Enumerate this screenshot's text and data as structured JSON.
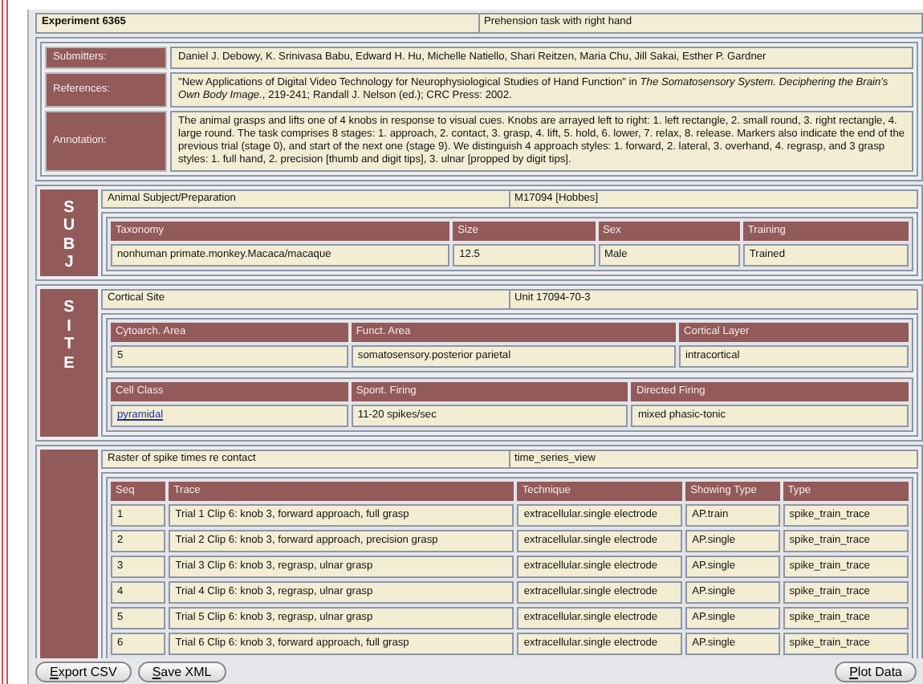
{
  "experiment": {
    "title": "Experiment 6365",
    "description": "Prehension task with right hand"
  },
  "info": [
    {
      "label": "Submitters:",
      "value": "Daniel J. Debowy, K. Srinivasa Babu, Edward H. Hu, Michelle Natiello, Shari Reitzen, Maria Chu, Jill Sakai, Esther P. Gardner"
    },
    {
      "label": "References:",
      "value": "\"New Applications of Digital Video Technology for Neurophysiological Studies of Hand Function\" in *The Somatosensory System. Deciphering the Brain's Own Body Image.*, 219-241; Randall J. Nelson (ed.); CRC Press: 2002."
    },
    {
      "label": "Annotation:",
      "value": "The animal grasps and lifts one of 4 knobs in response to visual cues. Knobs are arrayed left to right: 1. left rectangle, 2. small round, 3. right rectangle, 4. large round. The task comprises 8 stages: 1. approach, 2. contact, 3. grasp, 4. lift, 5. hold, 6. lower, 7. relax, 8. release. Markers also indicate the end of the previous trial (stage 0), and start of the next one (stage 9). We distinguish 4 approach styles: 1. forward, 2. lateral, 3. overhand, 4. regrasp, and 3 grasp styles: 1. full hand, 2. precision [thumb and digit tips], 3. ulnar [propped by digit tips]."
    }
  ],
  "sections": [
    {
      "side_label": "SUBJ",
      "title": "Animal Subject/Preparation",
      "value": "M17094 [Hobbes]",
      "tables": [
        {
          "columns": [
            "Taxonomy",
            "Size",
            "Sex",
            "Training"
          ],
          "rows": [
            [
              {
                "text": "nonhuman primate.monkey.Macaca/macaque"
              },
              {
                "text": "12.5"
              },
              {
                "text": "Male"
              },
              {
                "text": "Trained"
              }
            ]
          ]
        }
      ]
    },
    {
      "side_label": "SITE",
      "title": "Cortical Site",
      "value": "Unit 17094-70-3",
      "tables": [
        {
          "columns": [
            "Cytoarch. Area",
            "Funct. Area",
            "Cortical Layer"
          ],
          "rows": [
            [
              {
                "text": "5"
              },
              {
                "text": "somatosensory.posterior parietal"
              },
              {
                "text": "intracortical"
              }
            ]
          ]
        },
        {
          "columns": [
            "Cell Class",
            "Spont. Firing",
            "Directed Firing"
          ],
          "rows": [
            [
              {
                "text": "pyramidal",
                "link": true
              },
              {
                "text": "11-20 spikes/sec"
              },
              {
                "text": "mixed phasic-tonic"
              }
            ]
          ]
        }
      ]
    },
    {
      "title": "Raster of spike times re contact",
      "value": "time_series_view",
      "tables": [
        {
          "columns": [
            "Seq",
            "Trace",
            "Technique",
            "Showing Type",
            "Type"
          ],
          "rows": [
            [
              {
                "text": "1"
              },
              {
                "text": "Trial 1 Clip 6: knob 3, forward approach, full grasp"
              },
              {
                "text": "extracellular.single electrode"
              },
              {
                "text": "AP.train"
              },
              {
                "text": "spike_train_trace"
              }
            ],
            [
              {
                "text": "2"
              },
              {
                "text": "Trial 2 Clip 6: knob 3, forward approach, precision grasp"
              },
              {
                "text": "extracellular.single electrode"
              },
              {
                "text": "AP.single"
              },
              {
                "text": "spike_train_trace"
              }
            ],
            [
              {
                "text": "3"
              },
              {
                "text": "Trial 3 Clip 6: knob 3, regrasp, ulnar grasp"
              },
              {
                "text": "extracellular.single electrode"
              },
              {
                "text": "AP.single"
              },
              {
                "text": "spike_train_trace"
              }
            ],
            [
              {
                "text": "4"
              },
              {
                "text": "Trial 4 Clip 6: knob 3, regrasp, ulnar grasp"
              },
              {
                "text": "extracellular.single electrode"
              },
              {
                "text": "AP.single"
              },
              {
                "text": "spike_train_trace"
              }
            ],
            [
              {
                "text": "5"
              },
              {
                "text": "Trial 5 Clip 6: knob 3, regrasp, ulnar grasp"
              },
              {
                "text": "extracellular.single electrode"
              },
              {
                "text": "AP.single"
              },
              {
                "text": "spike_train_trace"
              }
            ],
            [
              {
                "text": "6"
              },
              {
                "text": "Trial 6 Clip 6: knob 3, forward approach, full grasp"
              },
              {
                "text": "extracellular.single electrode"
              },
              {
                "text": "AP.single"
              },
              {
                "text": "spike_train_trace"
              }
            ]
          ]
        }
      ]
    }
  ],
  "buttons_left": [
    "Export CSV",
    "Save XML"
  ],
  "buttons_right": [
    "Plot Data"
  ]
}
